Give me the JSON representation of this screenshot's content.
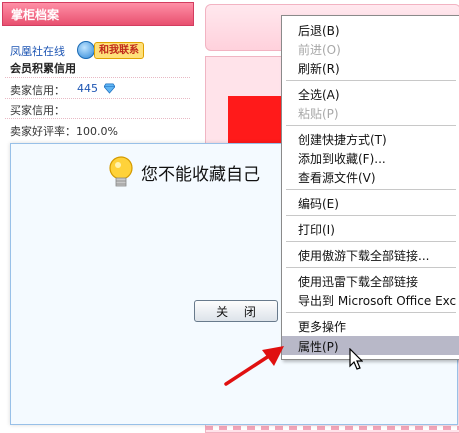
{
  "shop_panel": {
    "title": "掌柜档案",
    "shop_name": "凤凰社在线",
    "contact_label": "和我联系",
    "credit_heading": "会员积累信用",
    "seller_credit_label": "卖家信用：",
    "seller_credit_value": "445",
    "buyer_credit_label": "买家信用：",
    "positive_rate_label": "卖家好评率：100.0%"
  },
  "alert": {
    "message": "您不能收藏自己",
    "close_label": "关 闭"
  },
  "context_menu": {
    "items": [
      {
        "label": "后退(B)",
        "disabled": false
      },
      {
        "label": "前进(O)",
        "disabled": true
      },
      {
        "label": "刷新(R)",
        "disabled": false
      },
      {
        "label": "全选(A)",
        "disabled": false
      },
      {
        "label": "粘贴(P)",
        "disabled": true
      },
      {
        "label": "创建快捷方式(T)",
        "disabled": false
      },
      {
        "label": "添加到收藏(F)...",
        "disabled": false
      },
      {
        "label": "查看源文件(V)",
        "disabled": false
      },
      {
        "label": "编码(E)",
        "disabled": false
      },
      {
        "label": "打印(I)",
        "disabled": false
      },
      {
        "label": "使用傲游下载全部链接...",
        "disabled": false
      },
      {
        "label": "使用迅雷下载全部链接",
        "disabled": false
      },
      {
        "label": "导出到 Microsoft Office Exc",
        "disabled": false
      },
      {
        "label": "更多操作",
        "disabled": false
      },
      {
        "label": "属性(P)",
        "disabled": false,
        "selected": true
      }
    ]
  },
  "colors": {
    "panel_header": "#e8506f",
    "arrow": "#e01010",
    "menu_highlight": "#b8b8c8"
  }
}
